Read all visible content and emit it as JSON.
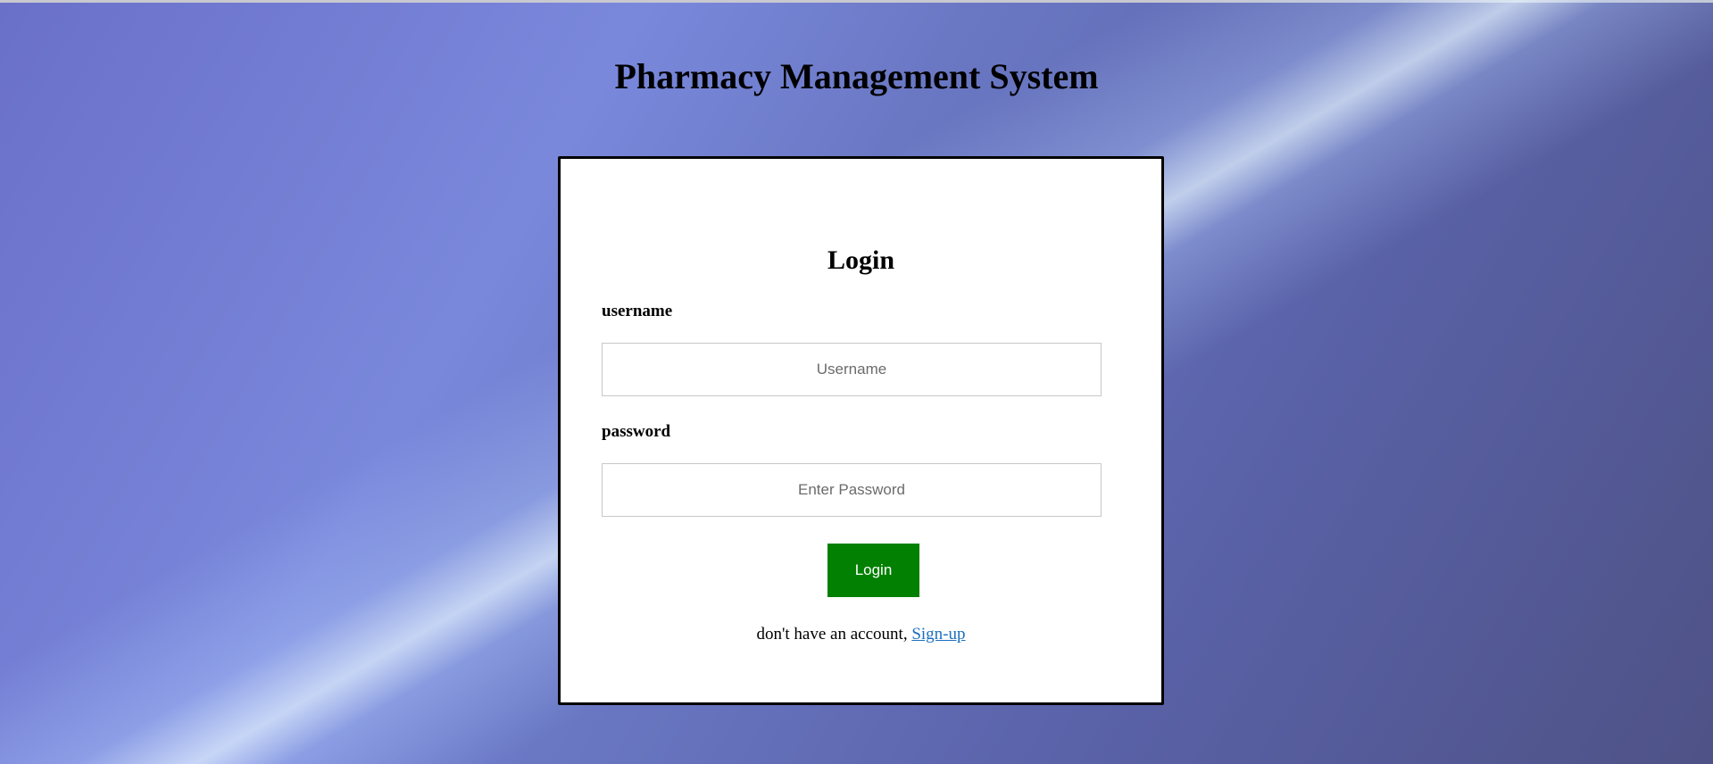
{
  "page": {
    "title": "Pharmacy Management System"
  },
  "login_form": {
    "heading": "Login",
    "username_label": "username",
    "username_placeholder": "Username",
    "username_value": "",
    "password_label": "password",
    "password_placeholder": "Enter Password",
    "password_value": "",
    "submit_label": "Login",
    "signup_prompt": "don't have an account, ",
    "signup_link": "Sign-up"
  },
  "colors": {
    "button_bg": "#028002",
    "link": "#1a6fc0",
    "card_border": "#000000"
  }
}
